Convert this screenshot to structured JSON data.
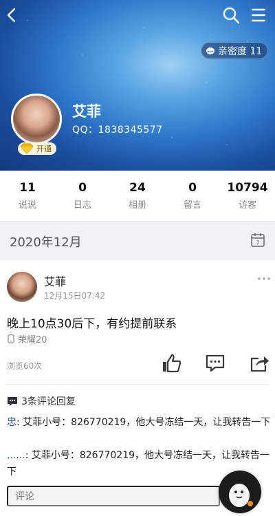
{
  "header": {
    "intimacy_label": "亲密度 11",
    "name": "艾菲",
    "qq": "QQ：1838345577",
    "vip_label": "开通"
  },
  "stats": [
    {
      "value": "11",
      "label": "说说"
    },
    {
      "value": "0",
      "label": "日志"
    },
    {
      "value": "24",
      "label": "相册"
    },
    {
      "value": "0",
      "label": "留言"
    },
    {
      "value": "10794",
      "label": "访客"
    }
  ],
  "timeline": {
    "month": "2020年12月",
    "calendar_day": "7"
  },
  "post": {
    "author": "艾菲",
    "time": "12月15日07:42",
    "text": "晚上10点30后下，有约提前联系",
    "device": "荣耀20",
    "views": "浏览60次",
    "comment_count_label": "3条评论回复",
    "comments": [
      {
        "name": "忠",
        "text": ": 艾菲小号：826770219，他大号冻结一天，让我转告一下"
      },
      {
        "name": "......",
        "text": ": 艾菲小号：826770219，他大号冻结一天，让我转告一下"
      }
    ],
    "comment_placeholder": "评论"
  },
  "icons": {
    "back": "back-arrow-icon",
    "search": "search-icon",
    "menu": "menu-icon",
    "calendar": "calendar-icon",
    "like": "thumbs-up-icon",
    "comment": "comment-icon",
    "share": "share-icon"
  }
}
